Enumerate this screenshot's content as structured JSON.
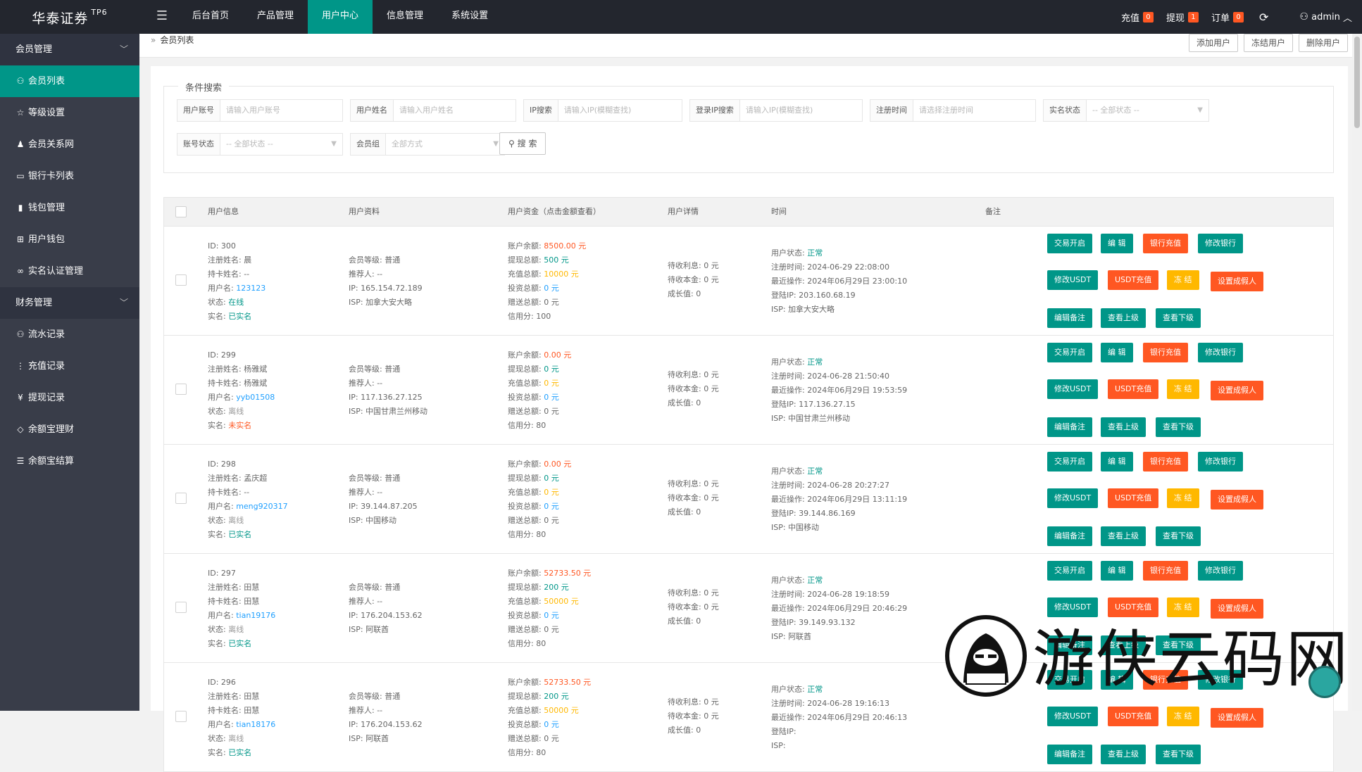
{
  "header": {
    "logo": "华泰证券",
    "logo_tag": "TP6",
    "menu_icon": "hamburger-icon",
    "nav": [
      "后台首页",
      "产品管理",
      "用户中心",
      "信息管理",
      "系统设置"
    ],
    "recharge_label": "充值",
    "recharge_count": "0",
    "withdraw_label": "提现",
    "withdraw_count": "1",
    "order_label": "订单",
    "order_count": "0",
    "user_label": "admin"
  },
  "sidebar": {
    "group1": "会员管理",
    "items1": [
      "会员列表",
      "等级设置",
      "会员关系网",
      "银行卡列表",
      "钱包管理",
      "用户钱包",
      "实名认证管理"
    ],
    "group2": "财务管理",
    "items2": [
      "流水记录",
      "充值记录",
      "提现记录",
      "余额宝理财",
      "余额宝结算"
    ]
  },
  "breadcrumb": "会员列表",
  "top_buttons": [
    "添加用户",
    "冻结用户",
    "删除用户"
  ],
  "search": {
    "legend": "条件搜索",
    "fields": [
      {
        "label": "用户账号",
        "placeholder": "请输入用户账号"
      },
      {
        "label": "用户姓名",
        "placeholder": "请输入用户姓名"
      },
      {
        "label": "IP搜索",
        "placeholder": "请输入IP(模糊查找)"
      },
      {
        "label": "登录IP搜索",
        "placeholder": "请输入IP(模糊查找)"
      },
      {
        "label": "注册时间",
        "placeholder": "请选择注册时间"
      },
      {
        "label": "实名状态",
        "placeholder": "-- 全部状态 --"
      },
      {
        "label": "账号状态",
        "placeholder": "-- 全部状态 --"
      },
      {
        "label": "会员组",
        "placeholder": "全部方式"
      }
    ],
    "button": "搜 索"
  },
  "table": {
    "headers": [
      "用户信息",
      "用户资料",
      "用户资金（点击金额查看）",
      "用户详情",
      "时间",
      "备注"
    ],
    "labels": {
      "id": "ID: ",
      "reg_name": "注册姓名: ",
      "holder": "持卡姓名: ",
      "username": "用户名: ",
      "status": "状态: ",
      "realname": "实名: ",
      "level": "会员等级: ",
      "referrer": "推荐人: ",
      "ip": "IP: ",
      "isp": "ISP: ",
      "balance": "账户余额: ",
      "withdraw_total": "提现总额: ",
      "recharge_total": "充值总额: ",
      "invest_total": "投资总额: ",
      "gift_total": "赠送总额: ",
      "credit": "信用分: ",
      "pending_interest": "待收利息: ",
      "pending_principal": "待收本金: ",
      "growth": "成长值: ",
      "user_status": "用户状态: ",
      "reg_time": "注册时间: ",
      "last_op": "最近操作: ",
      "login_ip": "登陆IP: "
    },
    "actions": [
      "交易开启",
      "编 辑",
      "银行充值",
      "修改银行",
      "修改USDT",
      "USDT充值",
      "冻 结",
      "设置成假人",
      "编辑备注",
      "查看上级",
      "查看下级"
    ],
    "rows": [
      {
        "id": "300",
        "reg_name": "晨",
        "holder": "--",
        "username": "123123",
        "status": "在线",
        "realname": "已实名",
        "level": "普通",
        "referrer": "--",
        "ip": "165.154.72.189",
        "isp": "加拿大安大略",
        "balance": "8500.00 元",
        "withdraw_total": "500 元",
        "recharge_total": "10000 元",
        "invest_total": "0 元",
        "gift_total": "0 元",
        "credit": "100",
        "pending_interest": "0 元",
        "pending_principal": "0 元",
        "growth": "0",
        "user_status": "正常",
        "reg_time": "2024-06-29 22:08:00",
        "last_op": "2024年06月29日 23:00:10",
        "login_ip": "203.160.68.19",
        "login_isp": "加拿大安大略"
      },
      {
        "id": "299",
        "reg_name": "杨雅斌",
        "holder": "杨雅斌",
        "username": "yyb01508",
        "status": "离线",
        "realname": "未实名",
        "level": "普通",
        "referrer": "--",
        "ip": "117.136.27.125",
        "isp": "中国甘肃兰州移动",
        "balance": "0.00 元",
        "withdraw_total": "0 元",
        "recharge_total": "0 元",
        "invest_total": "0 元",
        "gift_total": "0 元",
        "credit": "80",
        "pending_interest": "0 元",
        "pending_principal": "0 元",
        "growth": "0",
        "user_status": "正常",
        "reg_time": "2024-06-28 21:50:40",
        "last_op": "2024年06月29日 19:53:59",
        "login_ip": "117.136.27.15",
        "login_isp": "中国甘肃兰州移动"
      },
      {
        "id": "298",
        "reg_name": "孟庆超",
        "holder": "--",
        "username": "meng920317",
        "status": "离线",
        "realname": "已实名",
        "level": "普通",
        "referrer": "--",
        "ip": "39.144.87.205",
        "isp": "中国移动",
        "balance": "0.00 元",
        "withdraw_total": "0 元",
        "recharge_total": "0 元",
        "invest_total": "0 元",
        "gift_total": "0 元",
        "credit": "80",
        "pending_interest": "0 元",
        "pending_principal": "0 元",
        "growth": "0",
        "user_status": "正常",
        "reg_time": "2024-06-28 20:27:27",
        "last_op": "2024年06月29日 13:11:19",
        "login_ip": "39.144.86.169",
        "login_isp": "中国移动"
      },
      {
        "id": "297",
        "reg_name": "田慧",
        "holder": "田慧",
        "username": "tian19176",
        "status": "离线",
        "realname": "已实名",
        "level": "普通",
        "referrer": "--",
        "ip": "176.204.153.62",
        "isp": "阿联酋",
        "balance": "52733.50 元",
        "withdraw_total": "200 元",
        "recharge_total": "50000 元",
        "invest_total": "0 元",
        "gift_total": "0 元",
        "credit": "80",
        "pending_interest": "0 元",
        "pending_principal": "0 元",
        "growth": "0",
        "user_status": "正常",
        "reg_time": "2024-06-28 19:18:59",
        "last_op": "2024年06月29日 20:46:29",
        "login_ip": "39.149.93.132",
        "login_isp": "阿联酋"
      },
      {
        "id": "296",
        "reg_name": "田慧",
        "holder": "田慧",
        "username": "tian18176",
        "status": "离线",
        "realname": "已实名",
        "level": "普通",
        "referrer": "--",
        "ip": "176.204.153.62",
        "isp": "阿联酋",
        "balance": "52733.50 元",
        "withdraw_total": "200 元",
        "recharge_total": "50000 元",
        "invest_total": "0 元",
        "gift_total": "0 元",
        "credit": "80",
        "pending_interest": "0 元",
        "pending_principal": "0 元",
        "growth": "0",
        "user_status": "正常",
        "reg_time": "2024-06-28 19:16:13",
        "last_op": "2024年06月29日 20:46:13",
        "login_ip": "",
        "login_isp": ""
      }
    ]
  },
  "watermark": "游侠云码网"
}
